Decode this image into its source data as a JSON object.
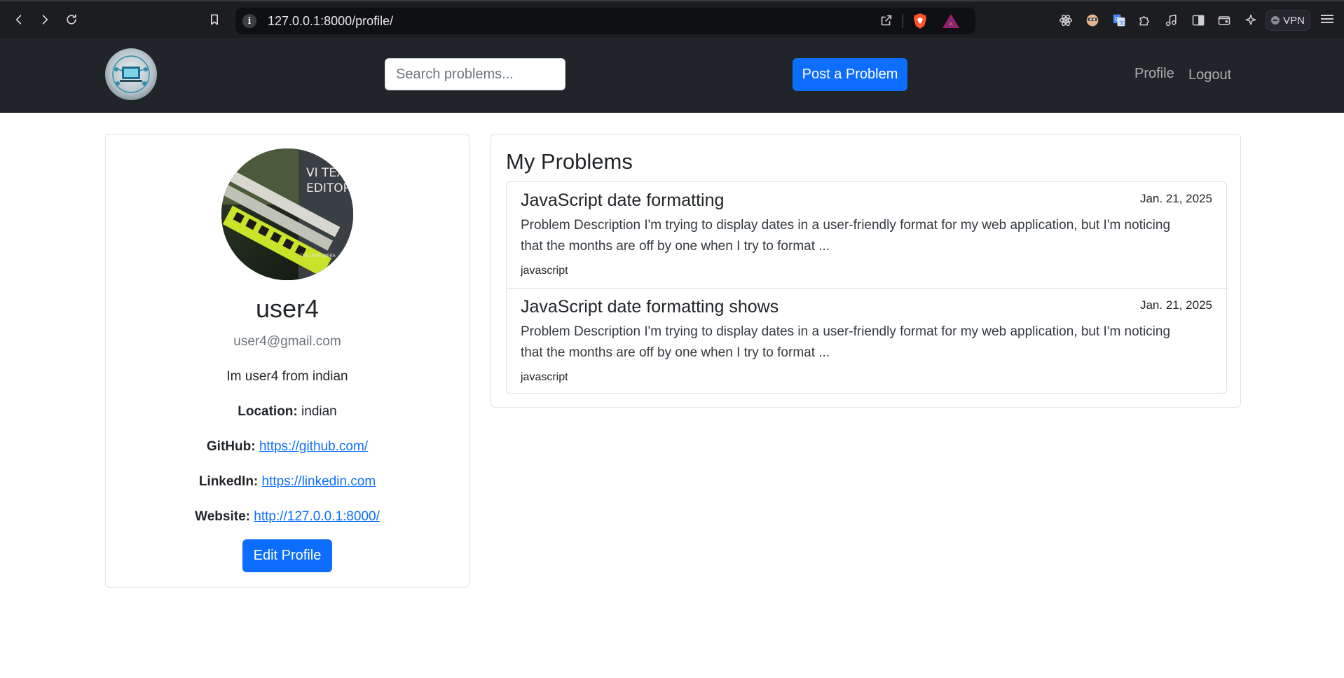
{
  "browser": {
    "url": "127.0.0.1:8000/profile/",
    "vpn_label": "VPN",
    "extensions": [
      "react-icon",
      "face-icon",
      "translate-icon",
      "puzzle-icon",
      "music-icon",
      "sidebar-icon",
      "wallet-icon",
      "sparkle-icon"
    ]
  },
  "navbar": {
    "search_placeholder": "Search problems...",
    "post_button": "Post a Problem",
    "links": {
      "profile": "Profile",
      "logout": "Logout"
    }
  },
  "profile": {
    "username": "user4",
    "email": "user4@gmail.com",
    "bio": "Im user4 from indian",
    "location_label": "Location:",
    "location": "indian",
    "github_label": "GitHub:",
    "github": "https://github.com/",
    "linkedin_label": "LinkedIn:",
    "linkedin": "https://linkedin.com",
    "website_label": "Website:",
    "website": "http://127.0.0.1:8000/",
    "edit_button": "Edit Profile",
    "avatar_text": [
      "VI TEX",
      "EDITOR",
      "THE UNIX OPERA"
    ]
  },
  "problems": {
    "heading": "My Problems",
    "items": [
      {
        "title": "JavaScript date formatting",
        "date": "Jan. 21, 2025",
        "description": "Problem Description I'm trying to display dates in a user-friendly format for my web application, but I'm noticing that the months are off by one when I try to format ...",
        "tag": "javascript"
      },
      {
        "title": "JavaScript date formatting shows",
        "date": "Jan. 21, 2025",
        "description": "Problem Description I'm trying to display dates in a user-friendly format for my web application, but I'm noticing that the months are off by one when I try to format ...",
        "tag": "javascript"
      }
    ]
  },
  "colors": {
    "primary": "#0d6efd",
    "navbar": "#212529",
    "chrome": "#1c1d21"
  }
}
